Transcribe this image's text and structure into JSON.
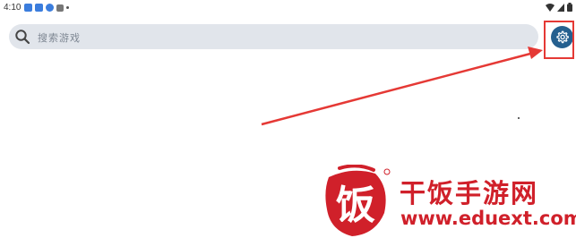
{
  "status_bar": {
    "time": "4:10",
    "notification_icons": [
      "mail-icon",
      "mail-icon",
      "app-icon",
      "app-icon",
      "dot-icon"
    ],
    "right_icons": [
      "wifi-icon",
      "signal-icon",
      "battery-icon"
    ]
  },
  "search": {
    "placeholder": "搜索游戏"
  },
  "settings": {
    "icon": "gear-icon",
    "color": "#25608f"
  },
  "annotation": {
    "color": "#e53935",
    "target": "settings-button"
  },
  "watermark": {
    "logo_text": "饭",
    "title": "干饭手游网",
    "url": "www.eduext.com",
    "color": "#d0202a"
  }
}
